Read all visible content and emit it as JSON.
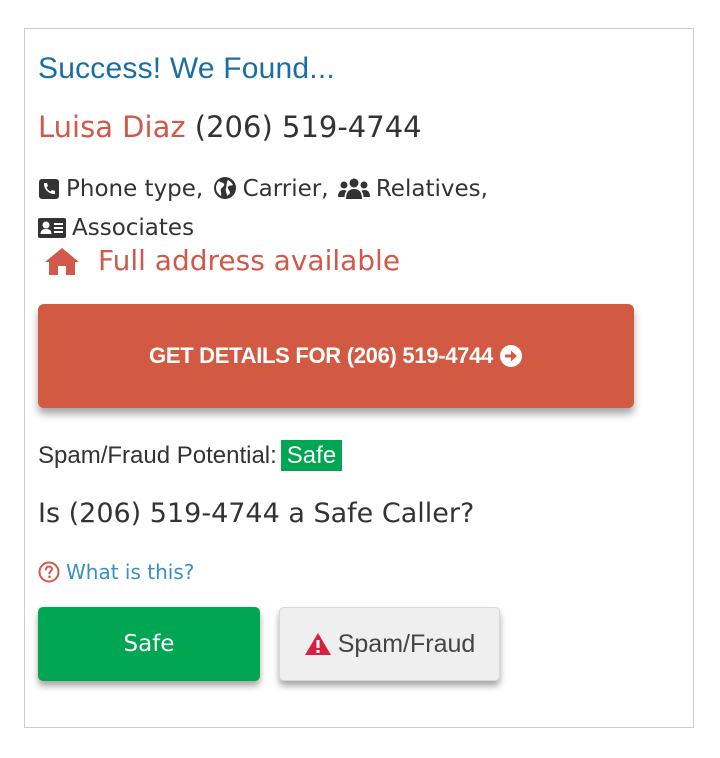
{
  "result": {
    "headline": "Success! We Found...",
    "name": "Luisa Diaz",
    "phone": "(206) 519-4744"
  },
  "features": [
    {
      "label": "Phone type,",
      "icon": "phone-square-icon"
    },
    {
      "label": "Carrier,",
      "icon": "globe-icon"
    },
    {
      "label": "Relatives,",
      "icon": "users-icon"
    },
    {
      "label": "Associates",
      "icon": "id-card-icon"
    }
  ],
  "address": {
    "label": "Full address available",
    "icon": "home-icon"
  },
  "cta": {
    "label": "GET DETAILS FOR (206) 519-4744",
    "icon": "arrow-circle-right-icon"
  },
  "spam": {
    "label": "Spam/Fraud Potential:",
    "status": "Safe",
    "question": "Is (206) 519-4744 a Safe Caller?",
    "help_link": "What is this?",
    "safe_button": "Safe",
    "fraud_button": "Spam/Fraud"
  },
  "colors": {
    "headline": "#1b6ea3",
    "accent_red": "#d0594b",
    "cta_bg": "#d35a42",
    "safe_green": "#00a651",
    "link_blue": "#3a8ec2",
    "warning_red": "#d81f3f"
  }
}
